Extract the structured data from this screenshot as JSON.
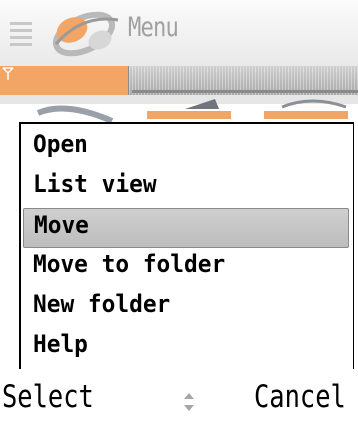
{
  "header": {
    "title": "Menu",
    "logo_icon": "menu-logo-icon",
    "lines_icon": "header-lines-icon"
  },
  "status": {
    "signal_icon": "signal-icon",
    "accent_color": "#f2a564"
  },
  "menu": {
    "items": [
      {
        "label": "Open",
        "selected": false
      },
      {
        "label": "List view",
        "selected": false
      },
      {
        "label": "Move",
        "selected": true
      },
      {
        "label": "Move to folder",
        "selected": false
      },
      {
        "label": "New folder",
        "selected": false
      },
      {
        "label": "Help",
        "selected": false
      }
    ]
  },
  "softkeys": {
    "left": "Select",
    "right": "Cancel",
    "scroll_icon": "scroll-arrows-icon"
  }
}
